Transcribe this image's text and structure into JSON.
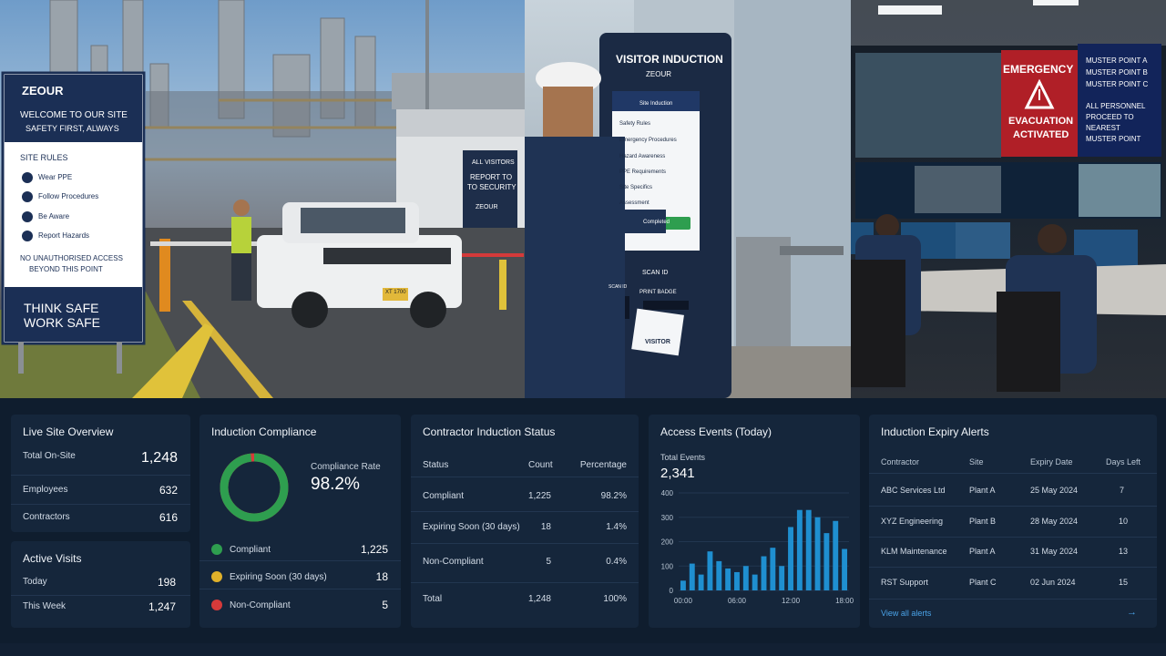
{
  "photos": {
    "site_sign": {
      "logo": "ZEOUR",
      "welcome": "WELCOME TO OUR SITE",
      "safety": "SAFETY FIRST, ALWAYS",
      "rules_title": "SITE RULES",
      "rules": [
        "Wear PPE",
        "Follow Procedures",
        "Be Aware",
        "Report Hazards"
      ],
      "no_access_1": "NO UNAUTHORISED ACCESS",
      "no_access_2": "BEYOND THIS POINT",
      "think_1": "THINK SAFE",
      "think_2": "WORK SAFE"
    },
    "booth_sign": {
      "line1": "ALL VISITORS",
      "line2": "REPORT TO",
      "line3": "TO SECURITY",
      "logo": "ZEOUR"
    },
    "plate": "XT 1700",
    "kiosk": {
      "title": "VISITOR INDUCTION",
      "logo": "ZEOUR",
      "screen_header": "Site Induction",
      "items": [
        "Safety Rules",
        "Emergency Procedures",
        "Hazard Awareness",
        "PPE Requirements",
        "Site Specifics",
        "Assessment"
      ],
      "completed": "Completed",
      "scan_id": "SCAN ID",
      "scan_id_small": "SCAN ID",
      "print_badge": "PRINT BADGE",
      "badge": "VISITOR"
    },
    "control_room": {
      "emergency": "EMERGENCY",
      "evacuation_1": "EVACUATION",
      "evacuation_2": "ACTIVATED",
      "muster": [
        "MUSTER POINT A",
        "MUSTER POINT B",
        "MUSTER POINT C"
      ],
      "proceed": [
        "ALL PERSONNEL",
        "PROCEED TO",
        "NEAREST",
        "MUSTER POINT"
      ]
    }
  },
  "live_site": {
    "title": "Live Site Overview",
    "rows": [
      {
        "label": "Total On-Site",
        "value": "1,248"
      },
      {
        "label": "Employees",
        "value": "632"
      },
      {
        "label": "Contractors",
        "value": "616"
      }
    ]
  },
  "active_visits": {
    "title": "Active Visits",
    "rows": [
      {
        "label": "Today",
        "value": "198"
      },
      {
        "label": "This Week",
        "value": "1,247"
      }
    ]
  },
  "induction_compliance": {
    "title": "Induction Compliance",
    "rate_label": "Compliance Rate",
    "rate": "98.2%",
    "rate_fraction": 0.982,
    "colors": {
      "compliant": "#2e9e4f",
      "expiring": "#e0b12a",
      "noncompliant": "#d63a3a"
    },
    "legend": [
      {
        "label": "Compliant",
        "value": "1,225"
      },
      {
        "label": "Expiring Soon (30 days)",
        "value": "18"
      },
      {
        "label": "Non-Compliant",
        "value": "5"
      }
    ]
  },
  "contractor_status": {
    "title": "Contractor Induction Status",
    "headers": [
      "Status",
      "Count",
      "Percentage"
    ],
    "rows": [
      [
        "Compliant",
        "1,225",
        "98.2%"
      ],
      [
        "Expiring Soon (30 days)",
        "18",
        "1.4%"
      ],
      [
        "Non-Compliant",
        "5",
        "0.4%"
      ],
      [
        "Total",
        "1,248",
        "100%"
      ]
    ]
  },
  "access_events": {
    "title": "Access Events (Today)",
    "total_label": "Total Events",
    "total": "2,341"
  },
  "chart_data": {
    "type": "bar",
    "title": "",
    "xlabel": "",
    "ylabel": "",
    "ylim": [
      0,
      400
    ],
    "yticks": [
      "400",
      "300",
      "200",
      "100",
      "0"
    ],
    "xticks": [
      "00:00",
      "06:00",
      "12:00",
      "18:00"
    ],
    "color": "#1f8fd0",
    "values": [
      40,
      110,
      65,
      160,
      120,
      90,
      75,
      100,
      65,
      140,
      175,
      100,
      260,
      330,
      330,
      300,
      235,
      285,
      170
    ]
  },
  "expiry_alerts": {
    "title": "Induction Expiry Alerts",
    "headers": [
      "Contractor",
      "Site",
      "Expiry Date",
      "Days Left"
    ],
    "rows": [
      [
        "ABC Services Ltd",
        "Plant A",
        "25 May 2024",
        "7"
      ],
      [
        "XYZ Engineering",
        "Plant B",
        "28 May 2024",
        "10"
      ],
      [
        "KLM Maintenance",
        "Plant A",
        "31 May 2024",
        "13"
      ],
      [
        "RST Support",
        "Plant C",
        "02 Jun 2024",
        "15"
      ]
    ],
    "view_all": "View all alerts",
    "arrow": "→"
  }
}
